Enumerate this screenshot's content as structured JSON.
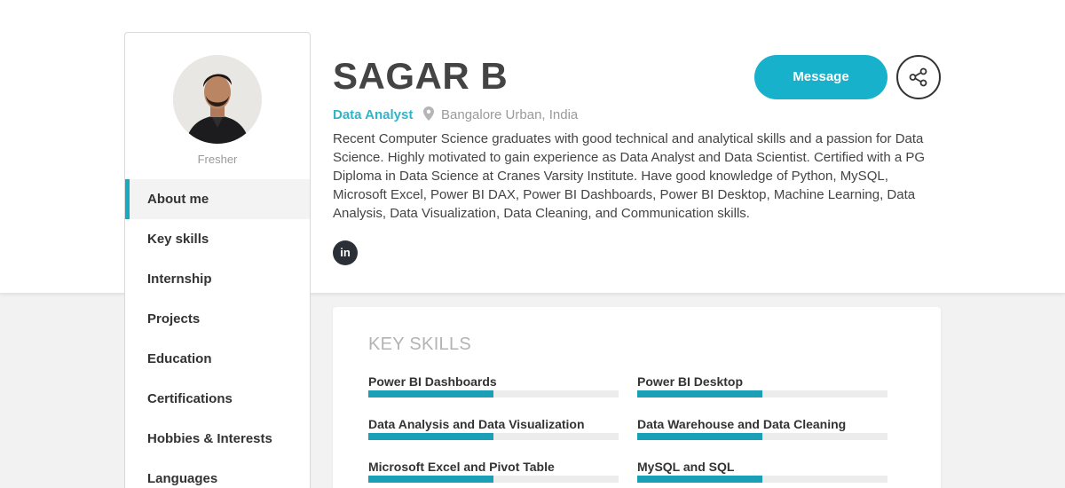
{
  "profile": {
    "name": "SAGAR B",
    "role": "Data Analyst",
    "location": "Bangalore Urban, India",
    "status": "Fresher",
    "summary": "Recent Computer Science graduates with good technical and analytical skills and a passion for Data Science. Highly motivated to gain experience as Data Analyst and Data Scientist. Certified with a PG Diploma in Data Science at Cranes Varsity Institute. Have good knowledge of Python, MySQL, Microsoft Excel, Power BI DAX, Power BI Dashboards, Power BI Desktop, Machine Learning, Data Analysis, Data Visualization, Data Cleaning, and Communication skills.",
    "linkedin_label": "in"
  },
  "actions": {
    "message_label": "Message",
    "share_icon": "share-icon"
  },
  "sidebar": {
    "items": [
      {
        "label": "About me",
        "active": true
      },
      {
        "label": "Key skills",
        "active": false
      },
      {
        "label": "Internship",
        "active": false
      },
      {
        "label": "Projects",
        "active": false
      },
      {
        "label": "Education",
        "active": false
      },
      {
        "label": "Certifications",
        "active": false
      },
      {
        "label": "Hobbies & Interests",
        "active": false
      },
      {
        "label": "Languages",
        "active": false
      }
    ]
  },
  "skills": {
    "title": "KEY SKILLS",
    "items": [
      {
        "name": "Power BI Dashboards",
        "level": 0.5
      },
      {
        "name": "Power BI Desktop",
        "level": 0.5
      },
      {
        "name": "Data Analysis and Data Visualization",
        "level": 0.5
      },
      {
        "name": "Data Warehouse and Data Cleaning",
        "level": 0.5
      },
      {
        "name": "Microsoft Excel and Pivot Table",
        "level": 0.5
      },
      {
        "name": "MySQL and SQL",
        "level": 0.5
      }
    ]
  },
  "colors": {
    "accent": "#17b1cc",
    "skill_bar": "#1aa0b6",
    "text_dark": "#333333",
    "text_muted": "#9a9a9a"
  }
}
